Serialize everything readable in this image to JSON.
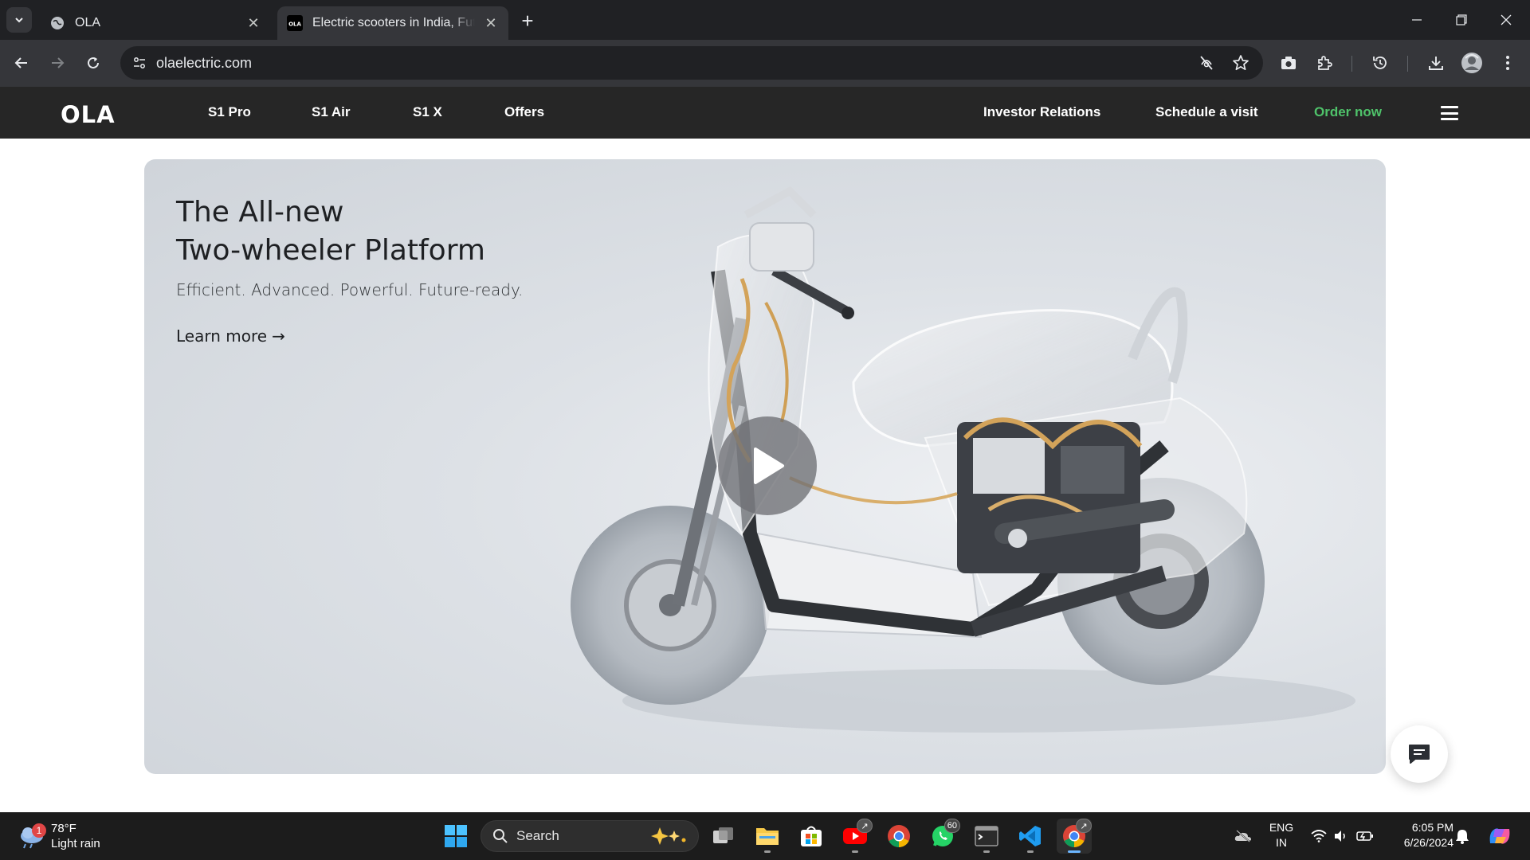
{
  "browser": {
    "tabs": [
      {
        "title": "OLA",
        "favicon": "globe-icon",
        "active": false
      },
      {
        "title": "Electric scooters in India, Future",
        "favicon": "ola-favicon-icon",
        "active": true
      }
    ],
    "url": "olaelectric.com"
  },
  "site": {
    "logo": "OLA",
    "nav_left": [
      "S1 Pro",
      "S1 Air",
      "S1 X",
      "Offers"
    ],
    "nav_right": {
      "investor": "Investor Relations",
      "schedule": "Schedule a visit",
      "order": "Order now"
    },
    "colors": {
      "nav_bg": "#262626",
      "order_green": "#4fc26a",
      "hero_bg": "#dde1e6"
    }
  },
  "hero": {
    "title_line1": "The All-new",
    "title_line2": "Two-wheeler Platform",
    "subtitle": "Efficient. Advanced. Powerful. Future-ready.",
    "link": "Learn more",
    "link_arrow": "→"
  },
  "taskbar": {
    "weather": {
      "temp": "78°F",
      "condition": "Light rain",
      "badge": "1"
    },
    "search_label": "Search",
    "whatsapp_badge": "60",
    "lang_line1": "ENG",
    "lang_line2": "IN",
    "time": "6:05 PM",
    "date": "6/26/2024"
  }
}
